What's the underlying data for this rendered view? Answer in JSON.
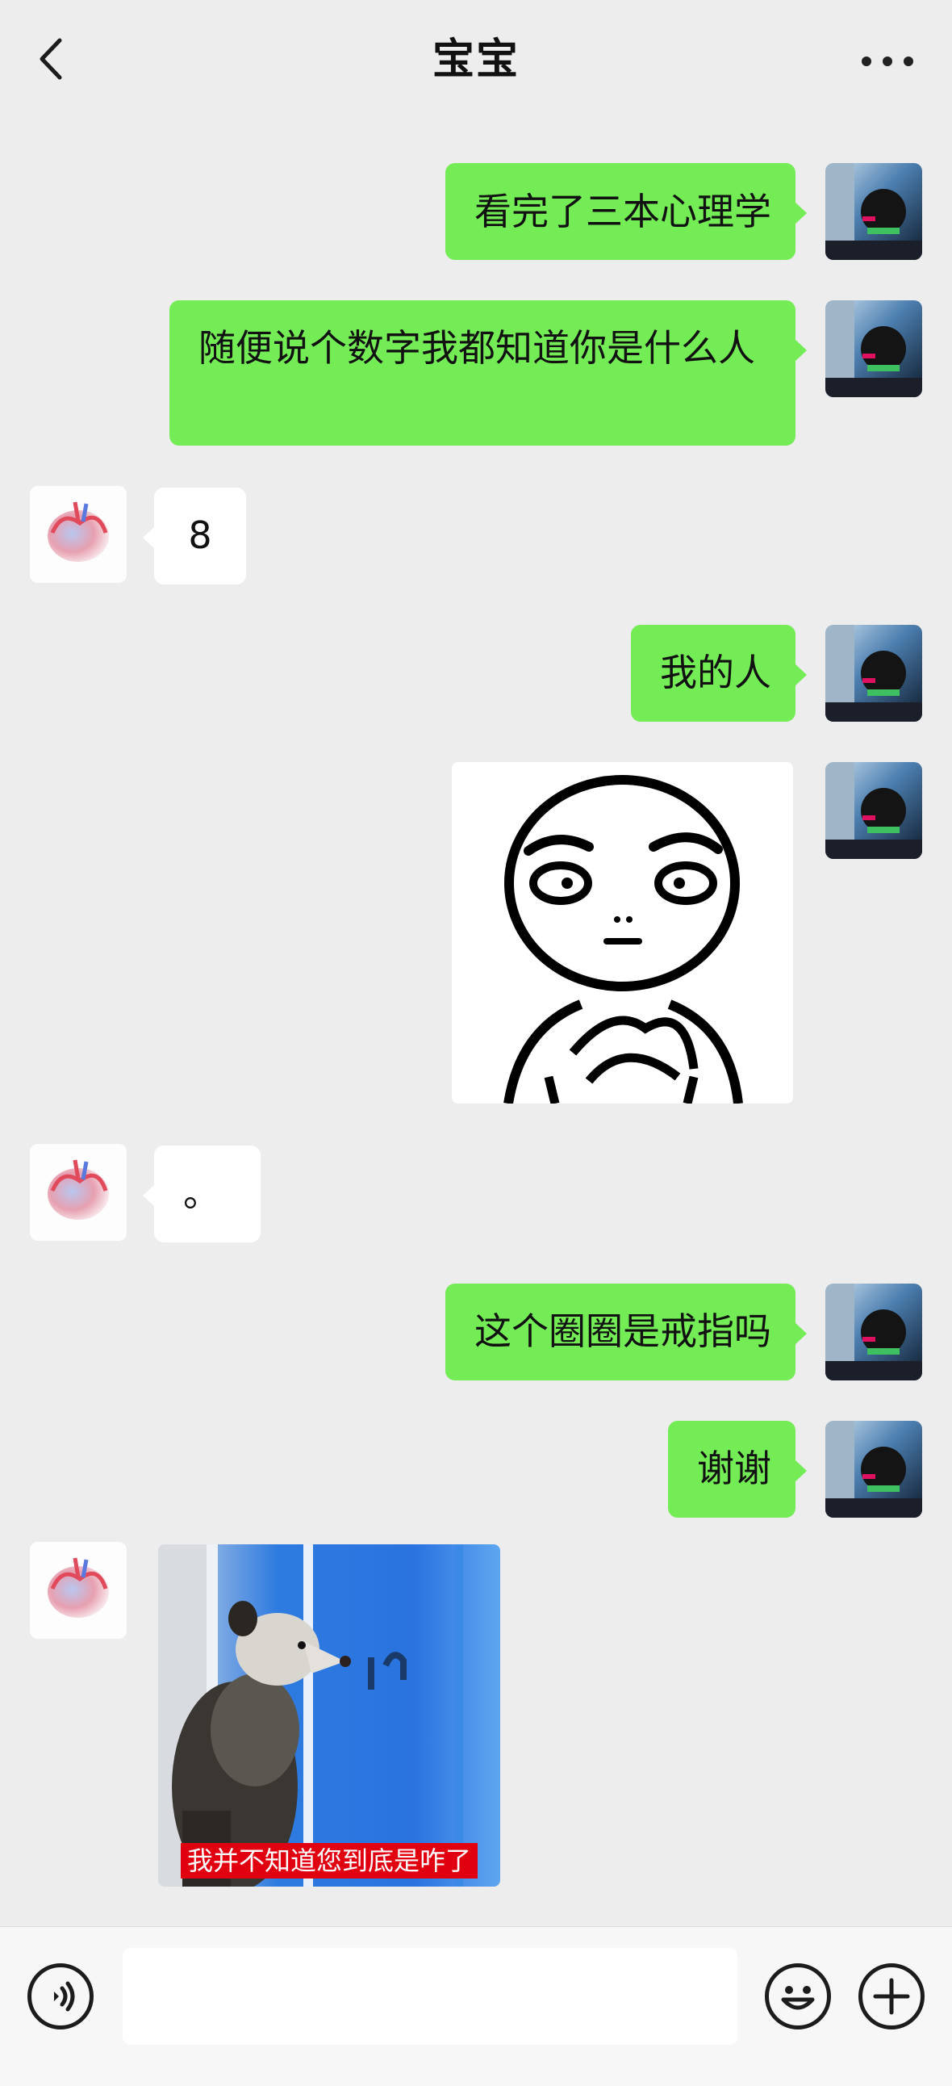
{
  "header": {
    "title": "宝宝",
    "back_icon": "chevron-left-icon",
    "more_icon": "more-dots-icon"
  },
  "messages": [
    {
      "from": "me",
      "type": "text",
      "text": "看完了三本心理学"
    },
    {
      "from": "me",
      "type": "text",
      "text": "随便说个数字我都知道你是什么人"
    },
    {
      "from": "other",
      "type": "text",
      "text": "8"
    },
    {
      "from": "me",
      "type": "text",
      "text": "我的人"
    },
    {
      "from": "me",
      "type": "image",
      "content": "sticker-cartoon-face-clasped-hands"
    },
    {
      "from": "other",
      "type": "text",
      "text": "。"
    },
    {
      "from": "me",
      "type": "text",
      "text": "这个圈圈是戒指吗"
    },
    {
      "from": "me",
      "type": "text",
      "text": "谢谢"
    },
    {
      "from": "other",
      "type": "image",
      "content": "sticker-opossum-at-window",
      "caption": "我并不知道您到底是咋了"
    }
  ],
  "input_bar": {
    "voice_icon": "voice-icon",
    "input_value": "",
    "emoji_icon": "emoji-icon",
    "plus_icon": "plus-icon"
  },
  "colors": {
    "background": "#ededed",
    "my_bubble": "#73ec55",
    "their_bubble": "#ffffff",
    "caption_bg": "#e10010"
  }
}
